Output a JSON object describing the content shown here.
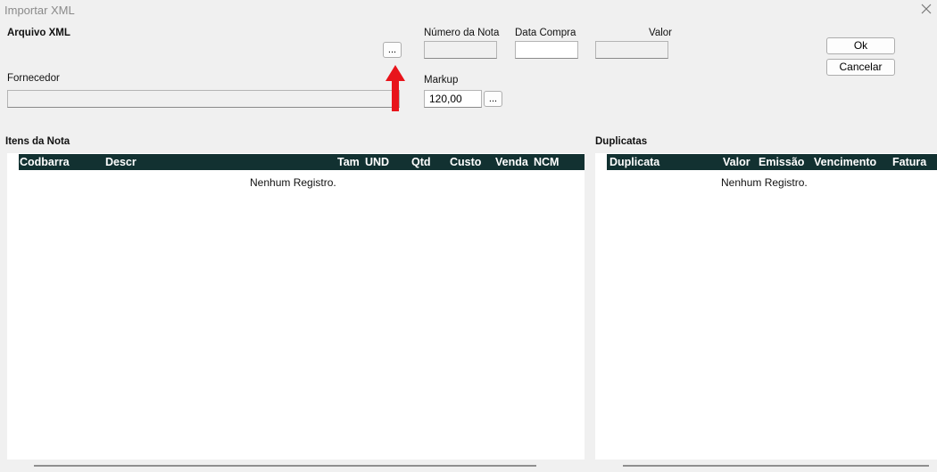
{
  "window": {
    "title": "Importar XML",
    "close_icon": "close-icon"
  },
  "form": {
    "arquivo_xml_label": "Arquivo XML",
    "browse_label": "...",
    "fornecedor_label": "Fornecedor",
    "numero_nota_label": "Número da Nota",
    "numero_nota_value": "",
    "data_compra_label": "Data Compra",
    "data_compra_value": "",
    "valor_label": "Valor",
    "valor_value": "",
    "markup_label": "Markup",
    "markup_value": "120,00",
    "markup_browse_label": "..."
  },
  "buttons": {
    "ok": "Ok",
    "cancel": "Cancelar"
  },
  "annotation": {
    "icon": "arrow-up-icon",
    "color": "#e8141b"
  },
  "itens_nota": {
    "title": "Itens da Nota",
    "columns": [
      "Codbarra",
      "Descr",
      "Tam",
      "UND",
      "Qtd",
      "Custo",
      "Venda",
      "NCM"
    ],
    "empty_message": "Nenhum Registro.",
    "header_color": "#123131"
  },
  "duplicatas": {
    "title": "Duplicatas",
    "columns": [
      "Duplicata",
      "Valor",
      "Emissão",
      "Vencimento",
      "Fatura"
    ],
    "empty_message": "Nenhum Registro."
  }
}
